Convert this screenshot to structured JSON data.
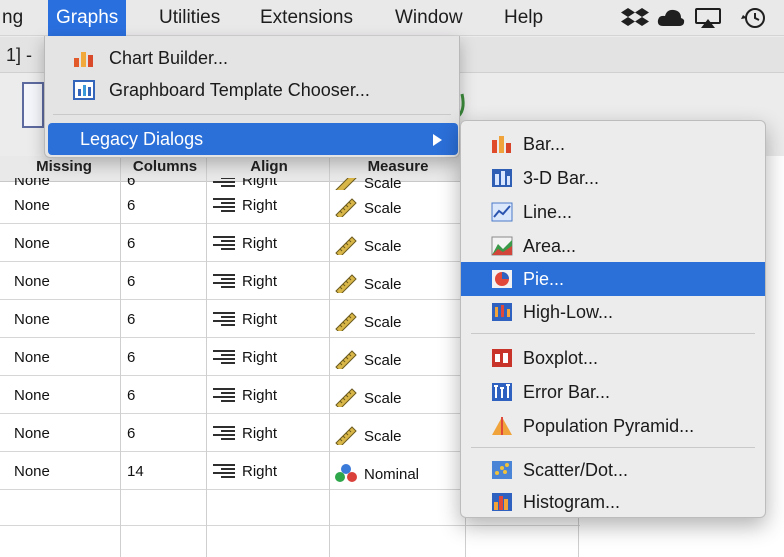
{
  "menubar": {
    "items": [
      "ng",
      "Graphs",
      "Utilities",
      "Extensions",
      "Window",
      "Help"
    ],
    "active_index": 1
  },
  "window": {
    "title_fragment": "1] -"
  },
  "table": {
    "headers": [
      "Missing",
      "Columns",
      "Align",
      "Measure"
    ],
    "clipped_row": {
      "missing": "None",
      "columns": "6",
      "align": "Right",
      "measure": "Scale"
    },
    "rows": [
      {
        "missing": "None",
        "columns": "6",
        "align": "Right",
        "measure": "Scale",
        "measure_icon": "ruler-icon"
      },
      {
        "missing": "None",
        "columns": "6",
        "align": "Right",
        "measure": "Scale",
        "measure_icon": "ruler-icon"
      },
      {
        "missing": "None",
        "columns": "6",
        "align": "Right",
        "measure": "Scale",
        "measure_icon": "ruler-icon"
      },
      {
        "missing": "None",
        "columns": "6",
        "align": "Right",
        "measure": "Scale",
        "measure_icon": "ruler-icon"
      },
      {
        "missing": "None",
        "columns": "6",
        "align": "Right",
        "measure": "Scale",
        "measure_icon": "ruler-icon"
      },
      {
        "missing": "None",
        "columns": "6",
        "align": "Right",
        "measure": "Scale",
        "measure_icon": "ruler-icon"
      },
      {
        "missing": "None",
        "columns": "6",
        "align": "Right",
        "measure": "Scale",
        "measure_icon": "ruler-icon"
      },
      {
        "missing": "None",
        "columns": "14",
        "align": "Right",
        "measure": "Nominal",
        "measure_icon": "nominal-icon"
      }
    ]
  },
  "graphs_menu": {
    "items": [
      {
        "label": "Chart Builder...",
        "icon": "chart-builder-icon"
      },
      {
        "label": "Graphboard Template Chooser...",
        "icon": "graphboard-icon"
      },
      {
        "label": "Legacy Dialogs",
        "has_submenu": true
      }
    ]
  },
  "legacy_submenu": {
    "highlighted_index": 4,
    "groups": [
      [
        "Bar...",
        "3-D Bar...",
        "Line...",
        "Area...",
        "Pie...",
        "High-Low..."
      ],
      [
        "Boxplot...",
        "Error Bar...",
        "Population Pyramid..."
      ],
      [
        "Scatter/Dot...",
        "Histogram..."
      ]
    ],
    "icons": [
      "bar-chart-icon",
      "3d-bar-chart-icon",
      "line-chart-icon",
      "area-chart-icon",
      "pie-chart-icon",
      "high-low-chart-icon",
      "boxplot-icon",
      "error-bar-icon",
      "population-pyramid-icon",
      "scatter-dot-icon",
      "histogram-icon"
    ]
  },
  "colors": {
    "accent": "#2b6fd8",
    "menubar": "#eae9ea"
  }
}
